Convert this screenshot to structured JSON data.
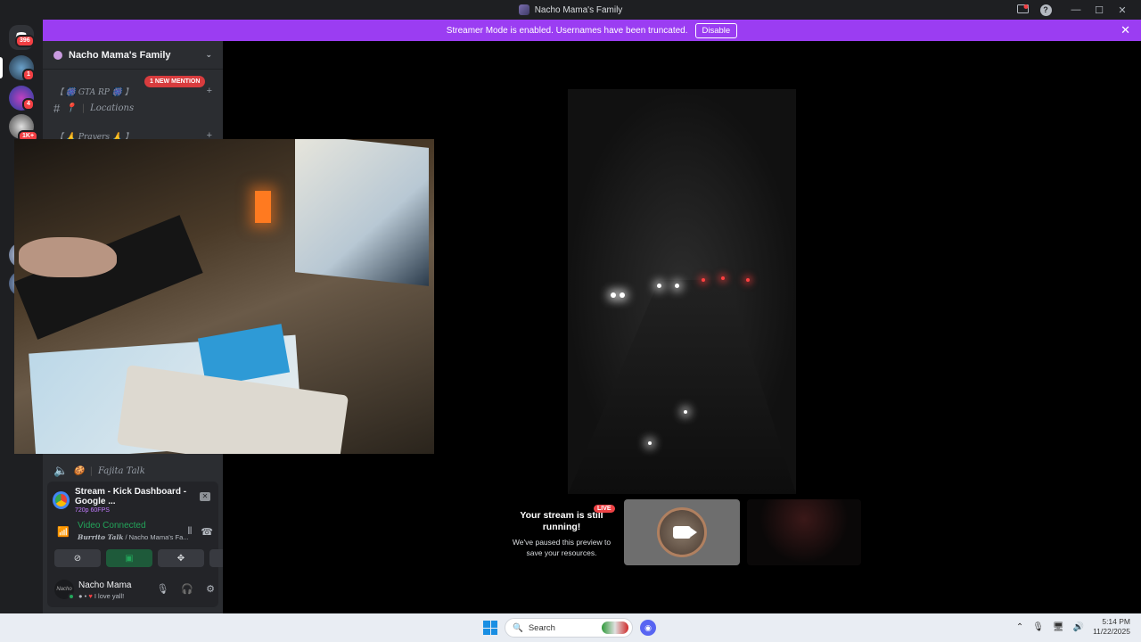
{
  "window": {
    "title": "Nacho Mama's Family"
  },
  "rail": {
    "home_badge": "396",
    "servers": [
      {
        "badge": "1"
      },
      {
        "badge": "4"
      },
      {
        "badge": "1K+"
      }
    ]
  },
  "banner": {
    "text": "Streamer Mode is enabled. Usernames have been truncated.",
    "disable_label": "Disable"
  },
  "sidebar": {
    "server_name": "Nacho Mama's Family",
    "mention_badge": "1 NEW MENTION",
    "categories": [
      {
        "label": "【 🎆 GTA RP 🎆 】"
      },
      {
        "label": "【 🙏 Prayers 🙏 】"
      }
    ],
    "channels": [
      {
        "icon": "📍",
        "label": "Locations"
      },
      {
        "icon": "🍪",
        "label": "Fajita Talk"
      }
    ]
  },
  "voice": {
    "stream_title": "Stream - Kick Dashboard - Google ...",
    "stream_quality": "720p 60FPS",
    "connected_label": "Video Connected",
    "channel_name": "Burrito Talk",
    "server_short": " / Nacho Mama's Fa..."
  },
  "user": {
    "avatar_text": "Nacho",
    "name": "Nacho Mama",
    "status": "I love yall!"
  },
  "stage": {
    "notice_title": "Your stream is still running!",
    "notice_sub": "We've paused this preview to save your resources.",
    "live_badge": "LIVE"
  },
  "taskbar": {
    "search_placeholder": "Search",
    "time": "5:14 PM",
    "date": "11/22/2025"
  },
  "colors": {
    "banner": "#9b3df2",
    "connected": "#23a55a",
    "live": "#ed4245"
  }
}
